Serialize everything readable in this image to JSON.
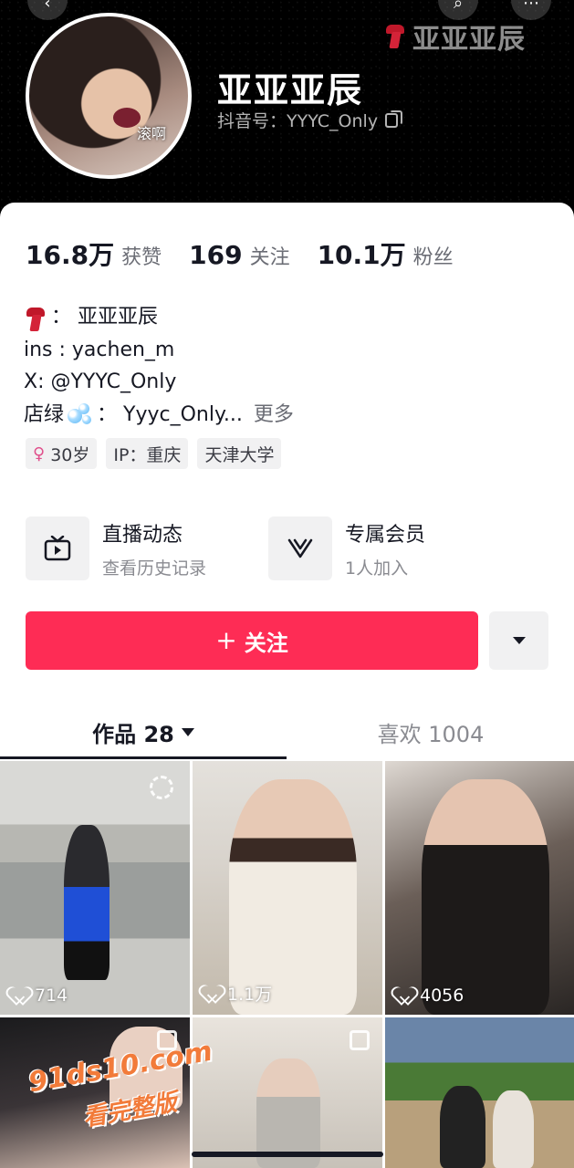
{
  "header": {
    "watermark_name": "亚亚亚辰",
    "display_name": "亚亚亚辰",
    "douyin_id": "抖音号：YYYC_Only",
    "avatar_caption": "滚啊"
  },
  "stats": [
    {
      "value": "16.8万",
      "label": "获赞"
    },
    {
      "value": "169",
      "label": "关注"
    },
    {
      "value": "10.1万",
      "label": "粉丝"
    }
  ],
  "bio": {
    "line1": "：  亚亚亚辰",
    "line2": "ins : yachen_m",
    "line3": "X:   @YYYC_Only",
    "line4_prefix": "店绿",
    "line4_value": "：  Yyyc_Only...",
    "more": "更多"
  },
  "tags": {
    "age": "30岁",
    "ip": "IP：重庆",
    "school": "天津大学"
  },
  "features": {
    "live": {
      "title": "直播动态",
      "subtitle": "查看历史记录",
      "icon": "tv-icon"
    },
    "member": {
      "title": "专属会员",
      "subtitle": "1人加入",
      "icon": "v-icon"
    }
  },
  "actions": {
    "follow_label": "关注"
  },
  "tabs": {
    "works": "作品 28",
    "likes": "喜欢 1004"
  },
  "grid": {
    "likes": [
      "714",
      "1.1万",
      "4056"
    ]
  },
  "watermark": {
    "site": "91ds10.com",
    "slogan": "看完整版"
  },
  "colors": {
    "accent": "#fe2c55",
    "header_bg": "#000000"
  }
}
